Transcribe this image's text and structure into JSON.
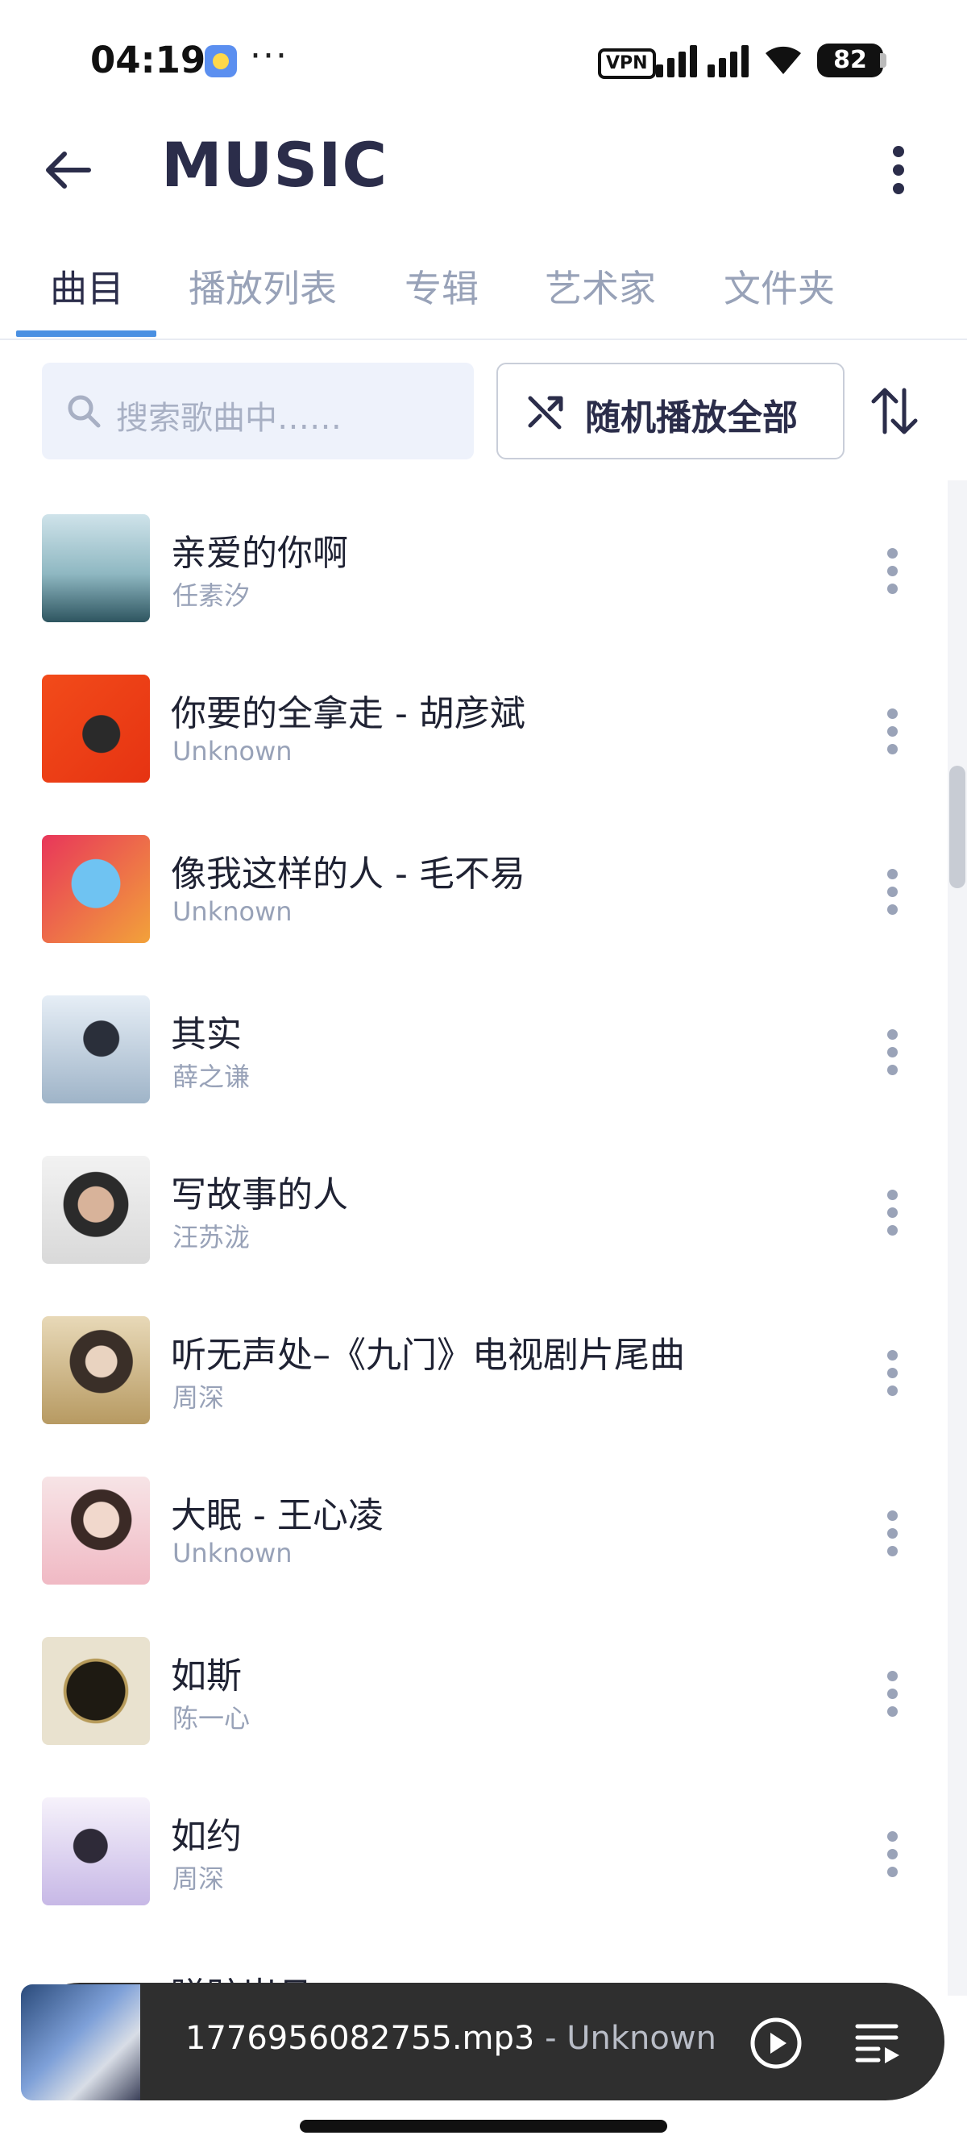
{
  "status_bar": {
    "time": "04:19",
    "more": "···",
    "vpn": "VPN",
    "battery": "82"
  },
  "header": {
    "title": "MUSIC",
    "back_icon": "arrow-left-icon",
    "menu_icon": "more-vertical-icon"
  },
  "tabs": [
    {
      "label": "曲目",
      "active": true
    },
    {
      "label": "播放列表",
      "active": false
    },
    {
      "label": "专辑",
      "active": false
    },
    {
      "label": "艺术家",
      "active": false
    },
    {
      "label": "文件夹",
      "active": false
    }
  ],
  "search": {
    "placeholder": "搜索歌曲中……"
  },
  "shuffle": {
    "label": "随机播放全部"
  },
  "songs": [
    {
      "title": "亲爱的你啊",
      "artist": "任素汐"
    },
    {
      "title": "你要的全拿走 - 胡彦斌",
      "artist": "Unknown"
    },
    {
      "title": "像我这样的人 - 毛不易",
      "artist": "Unknown"
    },
    {
      "title": "其实",
      "artist": "薛之谦"
    },
    {
      "title": "写故事的人",
      "artist": "汪苏泷"
    },
    {
      "title": "听无声处–《九门》电视剧片尾曲",
      "artist": "周深"
    },
    {
      "title": "大眠 - 王心凌",
      "artist": "Unknown"
    },
    {
      "title": "如斯",
      "artist": "陈一心"
    },
    {
      "title": "如约",
      "artist": "周深"
    }
  ],
  "partial_song": {
    "title": "蹉跎岁月"
  },
  "player": {
    "track": "1776956082755.mp3",
    "separator": " - ",
    "artist": "Unknown"
  },
  "colors": {
    "accent": "#4a90e2",
    "title": "#2b2d4a",
    "muted": "#98a2b8",
    "player_bg": "#2f2f2f"
  }
}
